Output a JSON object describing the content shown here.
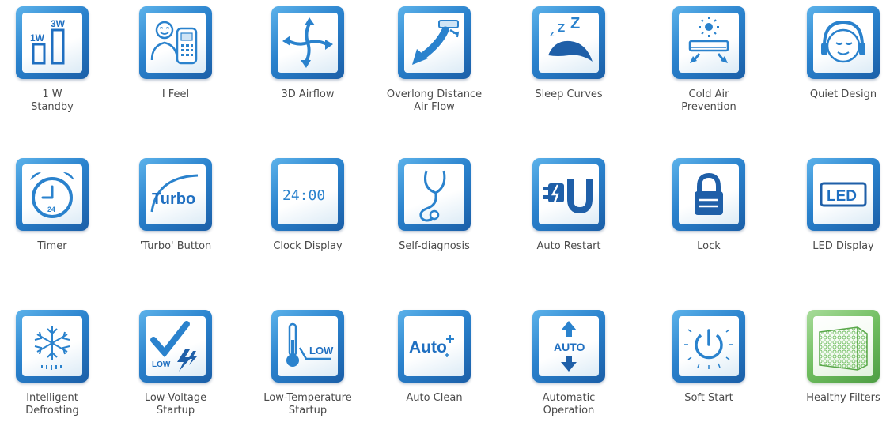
{
  "features": [
    {
      "label": "1 W\nStandby",
      "icon": "standby-power-icon",
      "text": [
        "1W",
        "3W"
      ]
    },
    {
      "label": "I Feel",
      "icon": "person-remote-icon"
    },
    {
      "label": "3D Airflow",
      "icon": "three-d-airflow-icon"
    },
    {
      "label": "Overlong Distance\nAir Flow",
      "icon": "long-distance-airflow-icon"
    },
    {
      "label": "Sleep Curves",
      "icon": "sleep-icon"
    },
    {
      "label": "Cold Air\nPrevention",
      "icon": "cold-air-prevention-icon"
    },
    {
      "label": "Quiet Design",
      "icon": "quiet-headphones-icon"
    },
    {
      "label": "Timer",
      "icon": "alarm-clock-icon",
      "text": [
        "24"
      ]
    },
    {
      "label": "'Turbo' Button",
      "icon": "turbo-icon",
      "text": [
        "Turbo"
      ]
    },
    {
      "label": "Clock Display",
      "icon": "clock-display-icon",
      "text": [
        "24:00"
      ]
    },
    {
      "label": "Self-diagnosis",
      "icon": "stethoscope-icon"
    },
    {
      "label": "Auto Restart",
      "icon": "plug-restart-icon"
    },
    {
      "label": "Lock",
      "icon": "padlock-icon"
    },
    {
      "label": "LED Display",
      "icon": "led-display-icon",
      "text": [
        "LED"
      ]
    },
    {
      "label": "Intelligent\nDefrosting",
      "icon": "snowflake-icon"
    },
    {
      "label": "Low-Voltage\nStartup",
      "icon": "low-voltage-icon",
      "text": [
        "LOW"
      ]
    },
    {
      "label": "Low-Temperature\nStartup",
      "icon": "low-temperature-icon",
      "text": [
        "LOW"
      ]
    },
    {
      "label": "Auto Clean",
      "icon": "auto-clean-icon",
      "text": [
        "Auto"
      ]
    },
    {
      "label": "Automatic\nOperation",
      "icon": "automatic-operation-icon",
      "text": [
        "AUTO"
      ]
    },
    {
      "label": "Soft Start",
      "icon": "soft-start-power-icon"
    },
    {
      "label": "Healthy Filters",
      "icon": "filter-mesh-icon"
    }
  ]
}
